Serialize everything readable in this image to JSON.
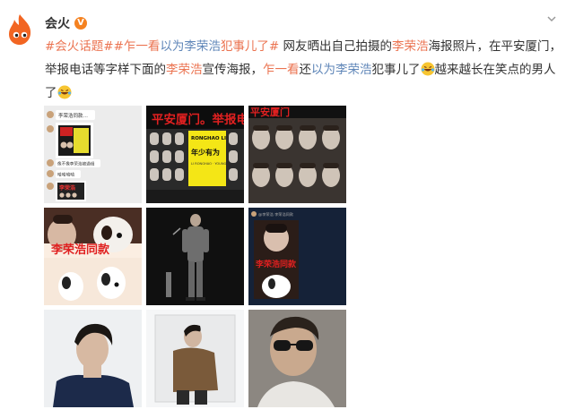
{
  "user": {
    "name": "会火",
    "verified_label": "V"
  },
  "post": {
    "topic": "#会火话题#",
    "hashtag": "#乍一看以为李荣浩犯事儿了#",
    "hashtag_prefix": "#乍一看",
    "hashtag_mid": "以为李荣浩",
    "hashtag_suffix": "犯事儿了#",
    "text1": " 网友晒出自己拍摄的",
    "name1": "李荣浩",
    "text2": "海报照片，在平安厦门，举报电话等字样下面的",
    "name2": "李荣浩",
    "text3": "宣传海报，",
    "phrase1": "乍一看",
    "text4": "还",
    "phrase2": "以为李荣浩",
    "text5": "犯事儿了",
    "text6": "越来越长在笑点的男人了"
  },
  "images": {
    "chat": {
      "msg1": "李荣浩同款…",
      "msg2": "像不像李荣浩被通缉",
      "msg3": "哈哈哈哈",
      "tag": "李荣浩"
    },
    "poster_wide": {
      "sign": "平安厦门。举报电",
      "name_en": "RONGHAO LI",
      "slogan": "年少有为",
      "sub": "LI RONGHAO · YOUNG"
    },
    "poster_close": {
      "sign": "平安厦门"
    },
    "dog1": {
      "caption": "李荣浩同款"
    },
    "dog2": {
      "caption": "李荣浩同款",
      "header": "@李荣浩 李荣浩同款"
    }
  },
  "colors": {
    "accent": "#eb7350",
    "link_blue": "#5f86b8",
    "verified": "#f58220"
  }
}
